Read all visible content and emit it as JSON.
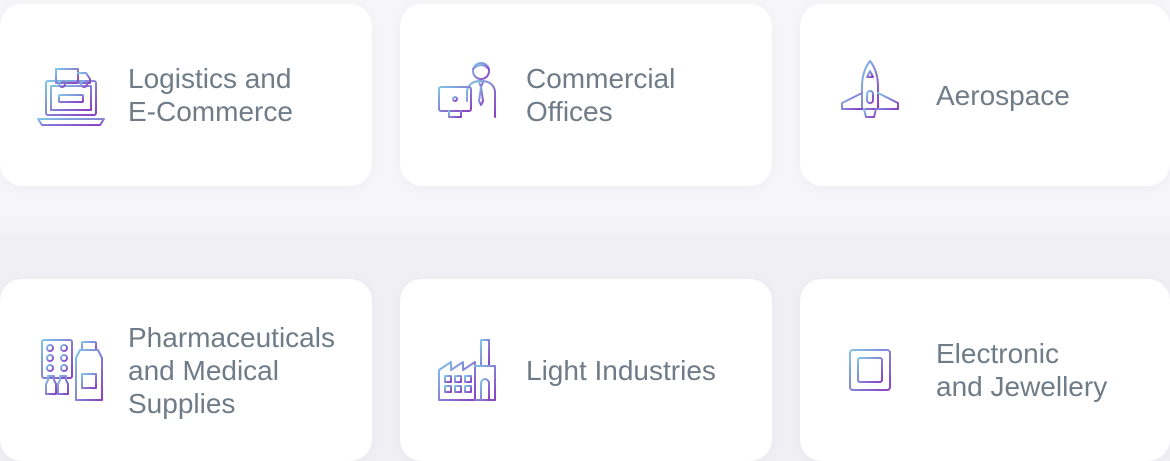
{
  "accent": {
    "gradient_start": "#7fc6e8",
    "gradient_end": "#8b3fc2",
    "label_color": "#6f7c88"
  },
  "industries": [
    {
      "label": "Logistics and\nE-Commerce",
      "icon": "laptop-delivery-truck-icon"
    },
    {
      "label": "Commercial\nOffices",
      "icon": "office-worker-computer-icon"
    },
    {
      "label": "Aerospace",
      "icon": "rocket-icon"
    },
    {
      "label": "Pharmaceuticals\nand Medical\nSupplies",
      "icon": "medicine-pills-bottle-icon"
    },
    {
      "label": "Light Industries",
      "icon": "factory-icon"
    },
    {
      "label": "Electronic\nand Jewellery",
      "icon": "microchip-icon"
    }
  ]
}
